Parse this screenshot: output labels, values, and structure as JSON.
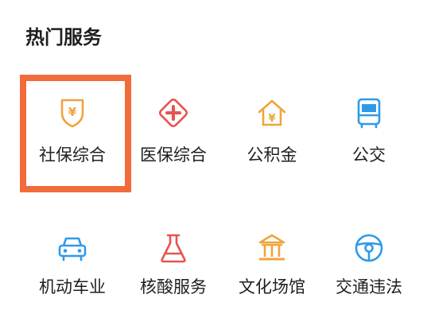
{
  "section": {
    "title": "热门服务"
  },
  "services": [
    {
      "label": "社保综合",
      "icon": "social-security-shield-icon",
      "color": "#f0a43c"
    },
    {
      "label": "医保综合",
      "icon": "medical-cross-icon",
      "color": "#e8534f"
    },
    {
      "label": "公积金",
      "icon": "housing-fund-house-icon",
      "color": "#f0a43c"
    },
    {
      "label": "公交",
      "icon": "bus-icon",
      "color": "#2f9ae8"
    },
    {
      "label": "机动车业",
      "icon": "car-icon",
      "color": "#2f9ae8"
    },
    {
      "label": "核酸服务",
      "icon": "flask-icon",
      "color": "#e8534f"
    },
    {
      "label": "文化场馆",
      "icon": "museum-icon",
      "color": "#f0a43c"
    },
    {
      "label": "交通违法",
      "icon": "steering-wheel-icon",
      "color": "#2f9ae8"
    }
  ],
  "highlight": {
    "color": "#f26b3a",
    "target": "社保综合"
  }
}
